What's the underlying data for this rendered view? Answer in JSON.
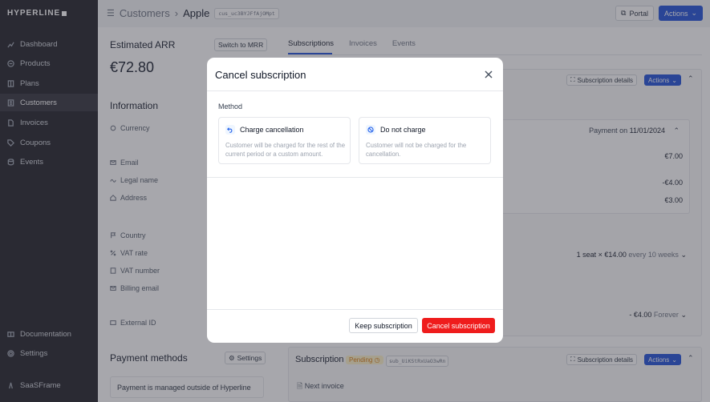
{
  "sidebar": {
    "logo": "HYPERLINE",
    "items": [
      {
        "label": "Dashboard",
        "icon": "chart-icon"
      },
      {
        "label": "Products",
        "icon": "box-icon"
      },
      {
        "label": "Plans",
        "icon": "book-icon"
      },
      {
        "label": "Customers",
        "icon": "building-icon"
      },
      {
        "label": "Invoices",
        "icon": "file-icon"
      },
      {
        "label": "Coupons",
        "icon": "tag-icon"
      },
      {
        "label": "Events",
        "icon": "database-icon"
      }
    ],
    "bottom": [
      {
        "label": "Documentation",
        "icon": "book-open-icon"
      },
      {
        "label": "Settings",
        "icon": "gear-icon"
      }
    ],
    "workspace": "SaaSFrame"
  },
  "header": {
    "crumb_parent": "Customers",
    "crumb_current": "Apple",
    "customer_id": "cus_uc3BYJFfAjOMpt",
    "portal_label": "Portal",
    "actions_label": "Actions"
  },
  "left": {
    "arr_title": "Estimated ARR",
    "switch_label": "Switch to MRR",
    "arr_value": "€72.80",
    "info_title": "Information",
    "fields": [
      "Currency",
      "Email",
      "Legal name",
      "Address",
      "Country",
      "VAT rate",
      "VAT number",
      "Billing email",
      "External ID"
    ],
    "payment_title": "Payment methods",
    "payment_settings": "Settings",
    "payment_note": "Payment is managed outside of Hyperline"
  },
  "right": {
    "tabs": [
      "Subscriptions",
      "Invoices",
      "Events"
    ],
    "details_label": "Subscription details",
    "actions_label": "Actions",
    "payment_on_label": "Payment on",
    "payment_on_date": "11/01/2024",
    "amounts": [
      "€7.00",
      "-€4.00",
      "€3.00"
    ],
    "seat_line_prefix": "1 seat × €14.00",
    "seat_line_suffix": "every 10 weeks",
    "forever_amount": "- €4.00",
    "forever_label": "Forever",
    "sub2_title": "Subscription",
    "sub2_status": "Pending",
    "sub2_id": "sub_UiKStRxUaO3wRn",
    "sub2_details_label": "Subscription details",
    "sub2_actions_label": "Actions",
    "next_invoice": "Next invoice"
  },
  "modal": {
    "title": "Cancel subscription",
    "method_label": "Method",
    "options": [
      {
        "title": "Charge cancellation",
        "desc": "Customer will be charged for the rest of the current period or a custom amount.",
        "icon": "undo-icon"
      },
      {
        "title": "Do not charge",
        "desc": "Customer will not be charged for the cancellation.",
        "icon": "ban-icon"
      }
    ],
    "keep_label": "Keep subscription",
    "cancel_label": "Cancel subscription"
  },
  "colors": {
    "accent": "#1d4ed8",
    "danger": "#ef1c1c",
    "sidebar_bg": "#1c1c24",
    "pending": "#d97706"
  }
}
